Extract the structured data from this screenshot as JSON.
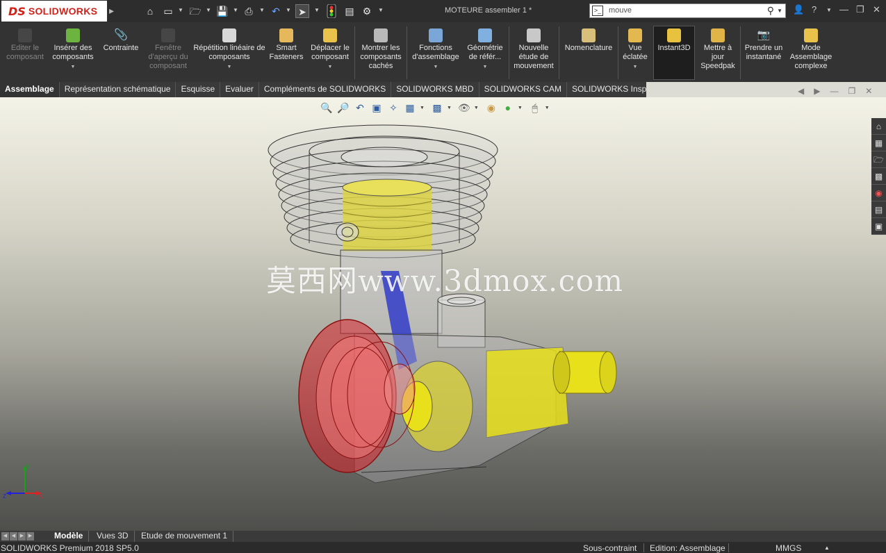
{
  "app": {
    "brand_mark": "DS",
    "brand_name": "SOLIDWORKS",
    "document_title": "MOTEURE assembler 1 *"
  },
  "search": {
    "value": "mouve"
  },
  "commands": [
    {
      "id": "edit-component",
      "label": "Editer le composant",
      "enabled": false,
      "icon": "edit-component-icon"
    },
    {
      "id": "insert-components",
      "label": "Insérer des composants",
      "enabled": true,
      "dropdown": true,
      "icon": "insert-components-icon"
    },
    {
      "id": "mate",
      "label": "Contrainte",
      "enabled": true,
      "icon": "paperclip-icon"
    },
    {
      "id": "component-preview",
      "label": "Fenêtre d'aperçu du composant",
      "enabled": false,
      "icon": "preview-window-icon"
    },
    {
      "id": "linear-pattern",
      "label": "Répétition linéaire de composants",
      "enabled": true,
      "dropdown": true,
      "icon": "linear-pattern-icon"
    },
    {
      "id": "smart-fasteners",
      "label": "Smart Fasteners",
      "enabled": true,
      "icon": "smart-fasteners-icon"
    },
    {
      "id": "move-component",
      "label": "Déplacer le composant",
      "enabled": true,
      "dropdown": true,
      "icon": "move-component-icon"
    },
    {
      "id": "show-hidden",
      "label": "Montrer les composants cachés",
      "enabled": true,
      "icon": "show-hidden-icon"
    },
    {
      "id": "assembly-features",
      "label": "Fonctions d'assemblage",
      "enabled": true,
      "dropdown": true,
      "icon": "assembly-features-icon"
    },
    {
      "id": "reference-geometry",
      "label": "Géométrie de référ...",
      "enabled": true,
      "dropdown": true,
      "icon": "reference-geometry-icon"
    },
    {
      "id": "new-motion-study",
      "label": "Nouvelle étude de mouvement",
      "enabled": true,
      "icon": "motion-study-icon"
    },
    {
      "id": "bill-of-materials",
      "label": "Nomenclature",
      "enabled": true,
      "icon": "bom-icon"
    },
    {
      "id": "exploded-view",
      "label": "Vue éclatée",
      "enabled": true,
      "dropdown": true,
      "icon": "exploded-view-icon"
    },
    {
      "id": "instant3d",
      "label": "Instant3D",
      "enabled": true,
      "active": true,
      "icon": "instant3d-icon"
    },
    {
      "id": "update-speedpak",
      "label": "Mettre à jour Speedpak",
      "enabled": true,
      "icon": "speedpak-icon"
    },
    {
      "id": "take-snapshot",
      "label": "Prendre un instantané",
      "enabled": true,
      "icon": "camera-icon"
    },
    {
      "id": "large-assembly",
      "label": "Mode Assemblage complexe",
      "enabled": true,
      "icon": "large-assembly-icon"
    }
  ],
  "tabs": [
    {
      "label": "Assemblage",
      "active": true
    },
    {
      "label": "Représentation schématique"
    },
    {
      "label": "Esquisse"
    },
    {
      "label": "Evaluer"
    },
    {
      "label": "Compléments de SOLIDWORKS"
    },
    {
      "label": "SOLIDWORKS MBD"
    },
    {
      "label": "SOLIDWORKS CAM"
    },
    {
      "label": "SOLIDWORKS Inspection"
    }
  ],
  "watermark": "莫西网www.3dmox.com",
  "bottom_tabs": [
    {
      "label": "Modèle",
      "active": true
    },
    {
      "label": "Vues 3D"
    },
    {
      "label": "Etude de mouvement 1"
    }
  ],
  "status": {
    "product": "SOLIDWORKS Premium 2018 SP5.0",
    "constraint": "Sous-contraint",
    "editing": "Edition: Assemblage",
    "units": "MMGS"
  },
  "colors": {
    "brand": "#d1211b",
    "cylinder_yellow": "#e8e01a",
    "rod_blue": "#3a44c8",
    "head_red": "#d8232a"
  },
  "triad_labels": {
    "y": "Y",
    "z": "Z",
    "x": "X"
  }
}
